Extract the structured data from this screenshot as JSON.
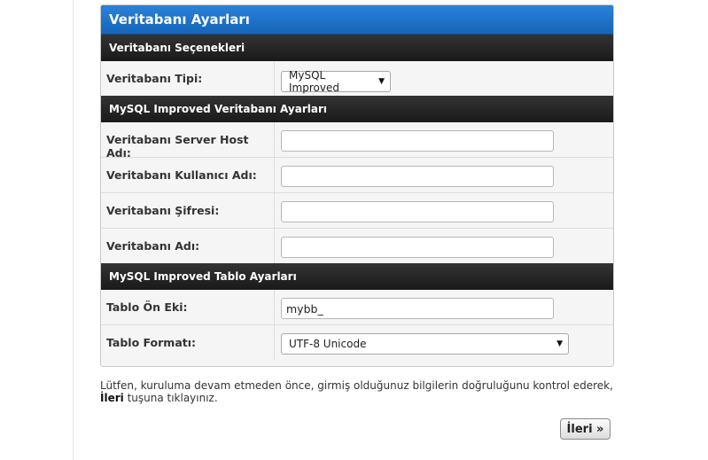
{
  "panel": {
    "title": "Veritabanı Ayarları",
    "section_options": "Veritabanı Seçenekleri",
    "db_type_label": "Veritabanı Tipi:",
    "db_type_value": "MySQL Improved",
    "section_db": "MySQL Improved Veritabanı Ayarları",
    "host_label": "Veritabanı Server Host Adı:",
    "host_value": "",
    "user_label": "Veritabanı Kullanıcı Adı:",
    "user_value": "",
    "password_label": "Veritabanı Şifresi:",
    "password_value": "",
    "dbname_label": "Veritabanı Adı:",
    "dbname_value": "",
    "section_table": "MySQL Improved Tablo Ayarları",
    "prefix_label": "Tablo Ön Eki:",
    "prefix_value": "mybb_",
    "format_label": "Tablo Formatı:",
    "format_value": "UTF-8 Unicode"
  },
  "note": {
    "before": "Lütfen, kuruluma devam etmeden önce, girmiş olduğunuz bilgilerin doğruluğunu kontrol ederek, ",
    "bold": "İleri",
    "after": " tuşuna tıklayınız."
  },
  "next_button_label": "İleri »",
  "icons": {
    "dropdown": "chevron-down-icon"
  }
}
